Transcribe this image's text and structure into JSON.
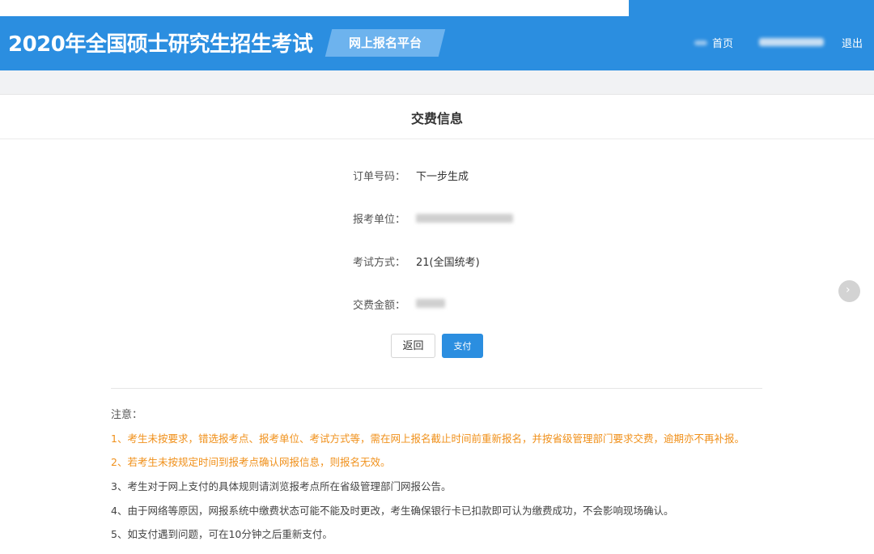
{
  "header": {
    "title": "2020年全国硕士研究生招生考试",
    "platform": "网上报名平台",
    "nav": {
      "home": "首页",
      "logout": "退出"
    }
  },
  "card": {
    "title": "交费信息",
    "fields": [
      {
        "label": "订单号码：",
        "value": "下一步生成"
      },
      {
        "label": "报考单位：",
        "value": ""
      },
      {
        "label": "考试方式：",
        "value": "21(全国统考)"
      },
      {
        "label": "交费金额：",
        "value": ""
      }
    ],
    "buttons": {
      "back": "返回",
      "pay": "支付"
    }
  },
  "notice": {
    "title": "注意：",
    "items": [
      {
        "text": "1、考生未按要求，错选报考点、报考单位、考试方式等，需在网上报名截止时间前重新报名，并按省级管理部门要求交费，逾期亦不再补报。",
        "type": "warn"
      },
      {
        "text": "2、若考生未按规定时间到报考点确认网报信息，则报名无效。",
        "type": "warn"
      },
      {
        "text": "3、考生对于网上支付的具体规则请浏览报考点所在省级管理部门网报公告。",
        "type": "normal"
      },
      {
        "text": "4、由于网络等原因，网报系统中缴费状态可能不能及时更改，考生确保银行卡已扣款即可认为缴费成功，不会影响现场确认。",
        "type": "normal"
      },
      {
        "text": "5、如支付遇到问题，可在10分钟之后重新支付。",
        "type": "normal"
      }
    ]
  },
  "colors": {
    "primary": "#2b8ee0",
    "warning": "#f0901a"
  },
  "icons": {
    "side": "chevron-right-icon"
  }
}
